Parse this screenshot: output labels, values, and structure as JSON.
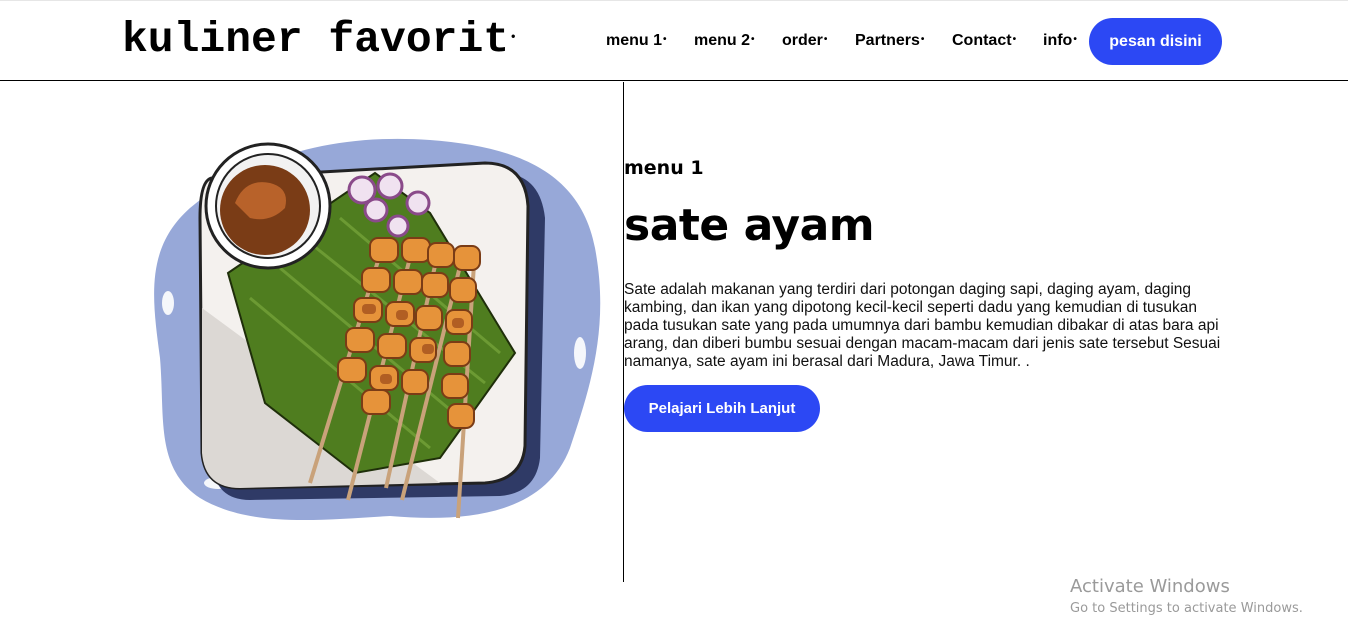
{
  "brand": "kuliner favorit",
  "nav": {
    "items": [
      {
        "label": "menu 1"
      },
      {
        "label": "menu 2"
      },
      {
        "label": "order"
      },
      {
        "label": "Partners"
      },
      {
        "label": "Contact"
      },
      {
        "label": "info"
      }
    ],
    "bullet": "•",
    "cta_label": "pesan disini"
  },
  "hero": {
    "subtitle": "menu 1",
    "title": "sate ayam",
    "description": "Sate adalah makanan yang terdiri dari potongan daging sapi, daging ayam, daging kambing, dan ikan yang dipotong kecil-kecil seperti dadu yang kemudian di tusukan pada tusukan sate yang pada umumnya dari bambu kemudian dibakar di atas bara api arang, dan diberi bumbu sesuai dengan macam-macam dari jenis sate tersebut Sesuai namanya, sate ayam ini berasal dari Madura, Jawa Timur. .",
    "button_label": "Pelajari Lebih Lanjut"
  },
  "watermark": {
    "title": "Activate Windows",
    "subtitle": "Go to Settings to activate Windows."
  },
  "colors": {
    "accent": "#2c48f4",
    "splash": "#97a8d8",
    "leaf": "#4f7d1f",
    "sauce": "#7a3c16",
    "meat": "#e6933a"
  }
}
